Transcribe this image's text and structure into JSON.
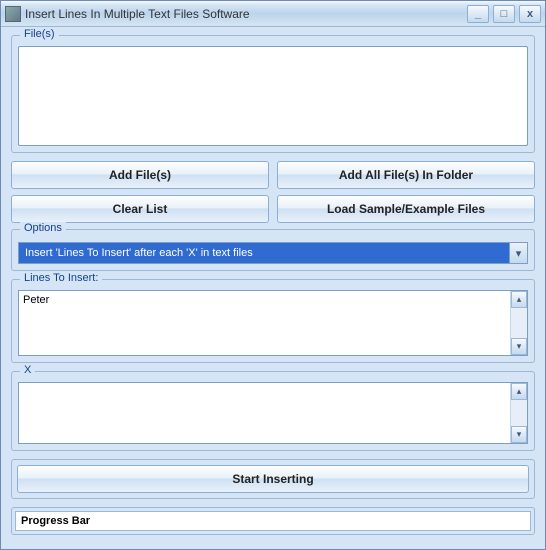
{
  "window": {
    "title": "Insert Lines In Multiple Text Files Software"
  },
  "files": {
    "label": "File(s)"
  },
  "buttons": {
    "add_files": "Add File(s)",
    "add_all_folder": "Add All File(s) In Folder",
    "clear_list": "Clear List",
    "load_sample": "Load Sample/Example Files",
    "start": "Start Inserting"
  },
  "options": {
    "label": "Options",
    "selected": "Insert 'Lines To Insert' after each 'X' in text files"
  },
  "lines_to_insert": {
    "label": "Lines To Insert:",
    "value": "Peter"
  },
  "x_section": {
    "label": "X",
    "value": ""
  },
  "progress": {
    "label": "Progress Bar"
  }
}
